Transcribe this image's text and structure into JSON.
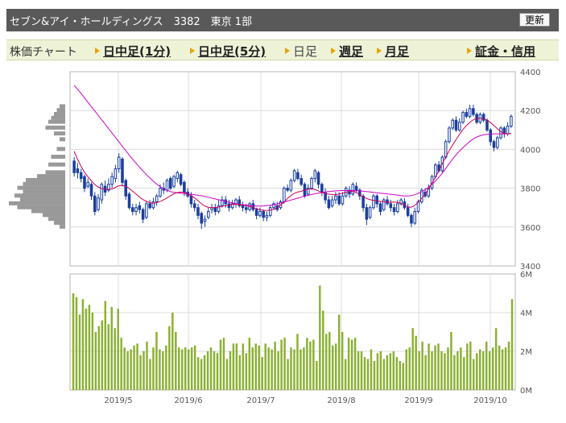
{
  "header": {
    "title": "セブン&アイ・ホールディングス　3382　東京 1部",
    "refresh_label": "更新"
  },
  "tabs": {
    "label": "株価チャート",
    "items": [
      {
        "label": "日中足(1分)",
        "link": true
      },
      {
        "label": "日中足(5分)",
        "link": true
      },
      {
        "label": "日足",
        "link": false
      },
      {
        "label": "週足",
        "link": true
      },
      {
        "label": "月足",
        "link": true
      },
      {
        "label": "証金・信用",
        "link": true
      }
    ]
  },
  "colors": {
    "candle": "#1a3fa0",
    "ma_short": "#cc0055",
    "ma_long": "#cc00cc",
    "volume": "#8bb033",
    "profile": "#999999"
  },
  "chart_data": [
    {
      "type": "candlestick",
      "title": "",
      "ylim": [
        3400,
        4400
      ],
      "y_ticks": [
        3400,
        3600,
        3800,
        4000,
        4200,
        4400
      ],
      "x_tick_labels": [
        "2019/5",
        "2019/6",
        "2019/7",
        "2019/8",
        "2019/9",
        "2019/10"
      ],
      "candles": [
        [
          3940,
          3880,
          3960,
          3860
        ],
        [
          3900,
          3880,
          3930,
          3850
        ],
        [
          3880,
          3850,
          3900,
          3830
        ],
        [
          3860,
          3800,
          3870,
          3780
        ],
        [
          3810,
          3830,
          3850,
          3800
        ],
        [
          3820,
          3760,
          3830,
          3740
        ],
        [
          3760,
          3680,
          3780,
          3660
        ],
        [
          3690,
          3750,
          3770,
          3680
        ],
        [
          3740,
          3820,
          3830,
          3720
        ],
        [
          3810,
          3780,
          3840,
          3760
        ],
        [
          3790,
          3820,
          3850,
          3780
        ],
        [
          3820,
          3860,
          3880,
          3800
        ],
        [
          3850,
          3900,
          3920,
          3830
        ],
        [
          3900,
          3960,
          3980,
          3880
        ],
        [
          3950,
          3830,
          3960,
          3810
        ],
        [
          3840,
          3760,
          3850,
          3740
        ],
        [
          3770,
          3700,
          3780,
          3690
        ],
        [
          3700,
          3680,
          3720,
          3660
        ],
        [
          3680,
          3700,
          3720,
          3660
        ],
        [
          3710,
          3690,
          3730,
          3670
        ],
        [
          3690,
          3640,
          3700,
          3620
        ],
        [
          3650,
          3720,
          3730,
          3640
        ],
        [
          3720,
          3700,
          3740,
          3690
        ],
        [
          3700,
          3730,
          3750,
          3690
        ],
        [
          3730,
          3760,
          3770,
          3710
        ],
        [
          3760,
          3800,
          3820,
          3750
        ],
        [
          3800,
          3790,
          3830,
          3770
        ],
        [
          3790,
          3840,
          3850,
          3780
        ],
        [
          3850,
          3800,
          3860,
          3790
        ],
        [
          3810,
          3860,
          3870,
          3800
        ],
        [
          3850,
          3880,
          3890,
          3830
        ],
        [
          3870,
          3820,
          3880,
          3810
        ],
        [
          3830,
          3780,
          3840,
          3760
        ],
        [
          3780,
          3760,
          3800,
          3750
        ],
        [
          3760,
          3720,
          3780,
          3700
        ],
        [
          3720,
          3700,
          3740,
          3680
        ],
        [
          3700,
          3660,
          3720,
          3640
        ],
        [
          3670,
          3620,
          3680,
          3590
        ],
        [
          3630,
          3640,
          3660,
          3600
        ],
        [
          3650,
          3680,
          3700,
          3640
        ],
        [
          3690,
          3700,
          3720,
          3670
        ],
        [
          3700,
          3680,
          3720,
          3660
        ],
        [
          3680,
          3710,
          3740,
          3670
        ],
        [
          3710,
          3740,
          3760,
          3700
        ],
        [
          3740,
          3720,
          3760,
          3700
        ],
        [
          3720,
          3700,
          3740,
          3680
        ],
        [
          3700,
          3720,
          3740,
          3690
        ],
        [
          3720,
          3740,
          3750,
          3700
        ],
        [
          3740,
          3710,
          3760,
          3700
        ],
        [
          3710,
          3700,
          3730,
          3680
        ],
        [
          3700,
          3690,
          3720,
          3670
        ],
        [
          3690,
          3720,
          3730,
          3680
        ],
        [
          3720,
          3690,
          3740,
          3680
        ],
        [
          3690,
          3660,
          3700,
          3640
        ],
        [
          3660,
          3680,
          3700,
          3650
        ],
        [
          3680,
          3650,
          3690,
          3630
        ],
        [
          3650,
          3660,
          3680,
          3630
        ],
        [
          3660,
          3700,
          3710,
          3650
        ],
        [
          3700,
          3720,
          3730,
          3690
        ],
        [
          3710,
          3690,
          3730,
          3680
        ],
        [
          3700,
          3730,
          3740,
          3690
        ],
        [
          3730,
          3800,
          3810,
          3720
        ],
        [
          3800,
          3790,
          3820,
          3780
        ],
        [
          3790,
          3840,
          3850,
          3780
        ],
        [
          3840,
          3890,
          3900,
          3830
        ],
        [
          3880,
          3850,
          3900,
          3840
        ],
        [
          3850,
          3820,
          3870,
          3810
        ],
        [
          3820,
          3760,
          3830,
          3750
        ],
        [
          3770,
          3800,
          3820,
          3760
        ],
        [
          3800,
          3850,
          3860,
          3790
        ],
        [
          3850,
          3890,
          3900,
          3830
        ],
        [
          3880,
          3820,
          3890,
          3800
        ],
        [
          3820,
          3780,
          3830,
          3760
        ],
        [
          3780,
          3740,
          3800,
          3720
        ],
        [
          3740,
          3700,
          3760,
          3690
        ],
        [
          3710,
          3740,
          3760,
          3700
        ],
        [
          3740,
          3760,
          3780,
          3720
        ],
        [
          3760,
          3720,
          3780,
          3710
        ],
        [
          3720,
          3760,
          3780,
          3710
        ],
        [
          3760,
          3800,
          3810,
          3750
        ],
        [
          3790,
          3770,
          3810,
          3750
        ],
        [
          3770,
          3820,
          3830,
          3760
        ],
        [
          3810,
          3790,
          3830,
          3780
        ],
        [
          3790,
          3760,
          3800,
          3740
        ],
        [
          3760,
          3700,
          3770,
          3680
        ],
        [
          3700,
          3640,
          3720,
          3610
        ],
        [
          3650,
          3700,
          3710,
          3640
        ],
        [
          3700,
          3760,
          3770,
          3690
        ],
        [
          3760,
          3720,
          3770,
          3700
        ],
        [
          3720,
          3680,
          3730,
          3660
        ],
        [
          3690,
          3740,
          3750,
          3680
        ],
        [
          3740,
          3720,
          3760,
          3710
        ],
        [
          3720,
          3700,
          3740,
          3680
        ],
        [
          3700,
          3680,
          3720,
          3660
        ],
        [
          3680,
          3720,
          3740,
          3670
        ],
        [
          3720,
          3740,
          3750,
          3710
        ],
        [
          3730,
          3700,
          3750,
          3690
        ],
        [
          3700,
          3660,
          3720,
          3650
        ],
        [
          3660,
          3620,
          3670,
          3600
        ],
        [
          3620,
          3680,
          3700,
          3610
        ],
        [
          3680,
          3730,
          3740,
          3670
        ],
        [
          3730,
          3790,
          3800,
          3720
        ],
        [
          3780,
          3760,
          3800,
          3750
        ],
        [
          3760,
          3800,
          3820,
          3750
        ],
        [
          3800,
          3860,
          3870,
          3790
        ],
        [
          3860,
          3920,
          3930,
          3850
        ],
        [
          3920,
          3890,
          3940,
          3880
        ],
        [
          3890,
          3960,
          3970,
          3880
        ],
        [
          3960,
          4040,
          4050,
          3950
        ],
        [
          4040,
          4110,
          4120,
          4030
        ],
        [
          4110,
          4150,
          4160,
          4100
        ],
        [
          4150,
          4100,
          4170,
          4090
        ],
        [
          4100,
          4140,
          4160,
          4090
        ],
        [
          4140,
          4190,
          4200,
          4130
        ],
        [
          4190,
          4170,
          4210,
          4160
        ],
        [
          4170,
          4210,
          4230,
          4160
        ],
        [
          4210,
          4180,
          4230,
          4170
        ],
        [
          4180,
          4140,
          4190,
          4130
        ],
        [
          4140,
          4180,
          4190,
          4130
        ],
        [
          4180,
          4150,
          4190,
          4140
        ],
        [
          4150,
          4100,
          4160,
          4090
        ],
        [
          4100,
          4040,
          4110,
          4020
        ],
        [
          4040,
          4010,
          4050,
          3990
        ],
        [
          4010,
          4060,
          4070,
          4000
        ],
        [
          4060,
          4110,
          4120,
          4050
        ],
        [
          4110,
          4080,
          4120,
          4060
        ],
        [
          4080,
          4120,
          4140,
          4070
        ],
        [
          4120,
          4170,
          4180,
          4110
        ]
      ],
      "ma_short": [
        3990,
        3950,
        3915,
        3885,
        3862,
        3842,
        3822,
        3808,
        3800,
        3795,
        3793,
        3795,
        3800,
        3810,
        3815,
        3812,
        3805,
        3792,
        3778,
        3764,
        3748,
        3738,
        3730,
        3725,
        3723,
        3727,
        3733,
        3742,
        3752,
        3762,
        3772,
        3778,
        3780,
        3778,
        3772,
        3763,
        3752,
        3738,
        3722,
        3710,
        3703,
        3700,
        3700,
        3702,
        3706,
        3709,
        3712,
        3716,
        3718,
        3717,
        3714,
        3711,
        3708,
        3704,
        3698,
        3693,
        3688,
        3685,
        3686,
        3688,
        3692,
        3702,
        3715,
        3730,
        3748,
        3762,
        3774,
        3780,
        3784,
        3790,
        3796,
        3798,
        3794,
        3788,
        3780,
        3774,
        3770,
        3768,
        3766,
        3768,
        3772,
        3776,
        3781,
        3784,
        3782,
        3774,
        3762,
        3752,
        3745,
        3740,
        3736,
        3734,
        3732,
        3730,
        3728,
        3728,
        3729,
        3727,
        3722,
        3712,
        3704,
        3702,
        3710,
        3726,
        3744,
        3764,
        3790,
        3818,
        3848,
        3880,
        3914,
        3948,
        3980,
        4010,
        4038,
        4064,
        4090,
        4112,
        4130,
        4145,
        4156,
        4160,
        4160,
        4156,
        4148,
        4136,
        4120,
        4104,
        4090,
        4082,
        4080,
        4082
      ],
      "ma_long": [
        4330,
        4310,
        4290,
        4268,
        4246,
        4224,
        4202,
        4180,
        4158,
        4136,
        4114,
        4092,
        4070,
        4048,
        4026,
        4004,
        3982,
        3960,
        3940,
        3920,
        3900,
        3882,
        3864,
        3848,
        3832,
        3818,
        3806,
        3796,
        3788,
        3782,
        3778,
        3776,
        3774,
        3772,
        3770,
        3768,
        3766,
        3764,
        3762,
        3758,
        3754,
        3750,
        3746,
        3742,
        3738,
        3734,
        3730,
        3726,
        3722,
        3719,
        3716,
        3714,
        3712,
        3710,
        3709,
        3708,
        3708,
        3709,
        3711,
        3713,
        3716,
        3720,
        3724,
        3729,
        3734,
        3739,
        3744,
        3749,
        3754,
        3759,
        3763,
        3767,
        3771,
        3774,
        3777,
        3780,
        3782,
        3784,
        3786,
        3787,
        3788,
        3788,
        3788,
        3788,
        3788,
        3787,
        3786,
        3784,
        3782,
        3780,
        3778,
        3776,
        3774,
        3772,
        3770,
        3768,
        3766,
        3764,
        3762,
        3760,
        3760,
        3762,
        3766,
        3772,
        3780,
        3790,
        3802,
        3816,
        3832,
        3850,
        3870,
        3892,
        3916,
        3940,
        3962,
        3982,
        4000,
        4016,
        4032,
        4046,
        4058,
        4066,
        4072,
        4076,
        4078,
        4080,
        4080,
        4080,
        4080,
        4080,
        4080,
        4082
      ],
      "price_profile": [
        {
          "price": 4220,
          "weight": 0.1
        },
        {
          "price": 4200,
          "weight": 0.15
        },
        {
          "price": 4180,
          "weight": 0.2
        },
        {
          "price": 4160,
          "weight": 0.25
        },
        {
          "price": 4140,
          "weight": 0.3
        },
        {
          "price": 4110,
          "weight": 0.35
        },
        {
          "price": 4080,
          "weight": 0.2
        },
        {
          "price": 4050,
          "weight": 0.1
        },
        {
          "price": 4000,
          "weight": 0.15
        },
        {
          "price": 3960,
          "weight": 0.25
        },
        {
          "price": 3920,
          "weight": 0.3
        },
        {
          "price": 3880,
          "weight": 0.35
        },
        {
          "price": 3860,
          "weight": 0.5
        },
        {
          "price": 3840,
          "weight": 0.7
        },
        {
          "price": 3820,
          "weight": 0.75
        },
        {
          "price": 3800,
          "weight": 0.85
        },
        {
          "price": 3780,
          "weight": 0.75
        },
        {
          "price": 3760,
          "weight": 0.9
        },
        {
          "price": 3740,
          "weight": 0.8
        },
        {
          "price": 3720,
          "weight": 1.0
        },
        {
          "price": 3700,
          "weight": 0.85
        },
        {
          "price": 3680,
          "weight": 0.6
        },
        {
          "price": 3660,
          "weight": 0.4
        },
        {
          "price": 3640,
          "weight": 0.3
        },
        {
          "price": 3620,
          "weight": 0.2
        },
        {
          "price": 3600,
          "weight": 0.1
        }
      ]
    },
    {
      "type": "bar",
      "title": "",
      "ylim": [
        0,
        6
      ],
      "y_tick_labels": [
        "0M",
        "2M",
        "4M",
        "6M"
      ],
      "y_tick_values": [
        0,
        2,
        4,
        6
      ],
      "values": [
        5.0,
        4.8,
        3.9,
        4.7,
        4.2,
        4.4,
        4.0,
        3.0,
        3.3,
        3.6,
        4.6,
        3.4,
        4.3,
        3.2,
        4.2,
        2.7,
        2.2,
        2.0,
        2.1,
        2.3,
        2.4,
        1.8,
        2.0,
        2.5,
        1.6,
        2.2,
        3.0,
        2.1,
        2.0,
        2.3,
        3.3,
        4.0,
        3.0,
        2.2,
        2.1,
        2.2,
        2.1,
        2.2,
        2.3,
        1.7,
        1.6,
        1.8,
        2.0,
        2.2,
        2.0,
        1.9,
        2.6,
        2.7,
        1.6,
        2.0,
        2.4,
        2.4,
        1.8,
        2.4,
        1.9,
        2.7,
        2.2,
        2.4,
        2.3,
        1.7,
        2.4,
        2.2,
        2.1,
        2.5,
        2.0,
        2.6,
        2.7,
        1.6,
        2.2,
        2.1,
        2.9,
        2.1,
        2.2,
        2.7,
        2.5,
        2.6,
        1.5,
        5.4,
        4.1,
        2.9,
        3.0,
        2.3,
        2.4,
        3.9,
        3.0,
        1.6,
        2.7,
        2.6,
        2.7,
        2.0,
        2.0,
        1.7,
        1.6,
        2.1,
        1.5,
        1.9,
        2.0,
        1.6,
        1.8,
        1.9,
        2.0,
        1.7,
        1.5,
        1.4,
        2.1,
        2.2,
        3.2,
        2.8,
        2.0,
        2.5,
        1.8,
        2.4,
        2.0,
        2.3,
        2.4,
        2.0,
        1.9,
        2.2,
        3.0,
        1.8,
        2.0,
        2.2,
        1.7,
        2.4,
        2.5,
        1.6,
        1.9,
        2.1,
        2.0,
        2.5,
        2.0,
        2.2,
        3.2,
        2.3,
        2.1,
        2.2,
        2.5,
        4.7
      ]
    }
  ]
}
